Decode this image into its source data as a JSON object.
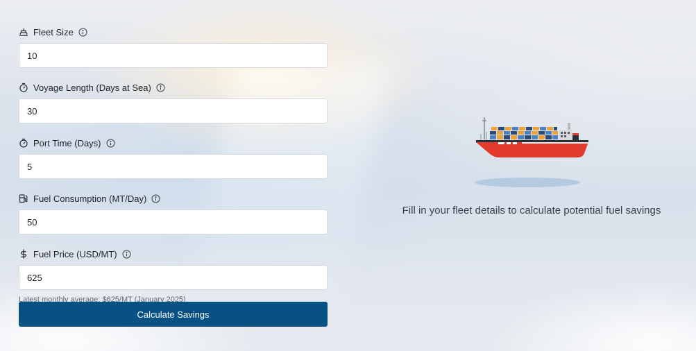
{
  "form": {
    "fields": [
      {
        "label": "Fleet Size",
        "icon": "ship-icon",
        "value": "10"
      },
      {
        "label": "Voyage Length (Days at Sea)",
        "icon": "timer-icon",
        "value": "30"
      },
      {
        "label": "Port Time (Days)",
        "icon": "timer-icon",
        "value": "5"
      },
      {
        "label": "Fuel Consumption (MT/Day)",
        "icon": "fuel-pump-icon",
        "value": "50"
      },
      {
        "label": "Fuel Price (USD/MT)",
        "icon": "dollar-icon",
        "value": "625"
      }
    ],
    "price_hint": "Latest monthly average: $625/MT (January 2025)",
    "submit_label": "Calculate Savings"
  },
  "results": {
    "empty_message": "Fill in your fleet details to calculate potential fuel savings",
    "illustration": "container-ship-illustration"
  },
  "colors": {
    "primary_button": "#075283",
    "ship_hull": "#e23b2e",
    "text": "#1f2328"
  }
}
